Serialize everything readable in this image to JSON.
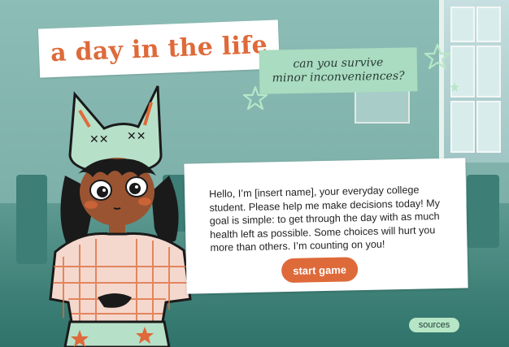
{
  "title": "a day in the life",
  "subtitle": {
    "line1": "can you survive",
    "line2": "minor inconveniences?"
  },
  "dialogue": {
    "text": "Hello, I’m [insert name], your everyday college student. Please help me make decisions today! My goal is simple: to get through the day with as much health left as possible. Some choices will hurt you more than others. I’m counting on you!"
  },
  "buttons": {
    "start_label": "start game",
    "sources_label": "sources"
  },
  "colors": {
    "accent_orange": "#de6a3a",
    "mint": "#a9dcc0",
    "teal_background": "#7fb1aa",
    "sources_pill": "#b7e6c7"
  },
  "icons": [
    "star-icon",
    "star-icon",
    "star-icon"
  ]
}
